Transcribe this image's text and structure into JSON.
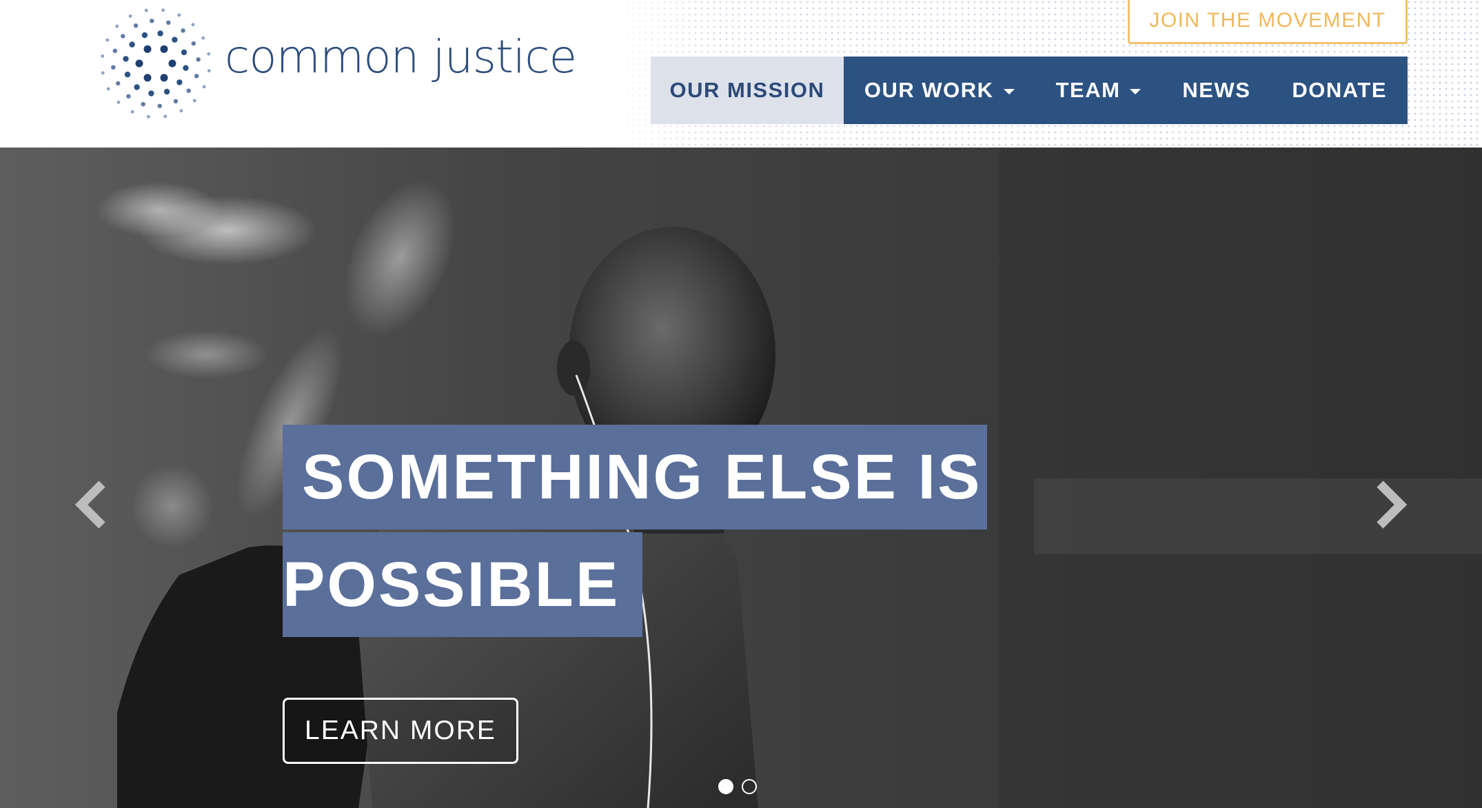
{
  "brand": {
    "name": "common justice",
    "logo_icon": "starburst-dots-icon",
    "color_primary": "#2c5282",
    "color_accent": "#f0b95c"
  },
  "header": {
    "cta_label": "JOIN THE MOVEMENT",
    "nav": [
      {
        "label": "OUR MISSION",
        "active": true,
        "dropdown": false
      },
      {
        "label": "OUR WORK",
        "active": false,
        "dropdown": true
      },
      {
        "label": "TEAM",
        "active": false,
        "dropdown": true
      },
      {
        "label": "NEWS",
        "active": false,
        "dropdown": false
      },
      {
        "label": "DONATE",
        "active": false,
        "dropdown": false
      }
    ]
  },
  "hero": {
    "headline_line1": "SOMETHING ELSE IS",
    "headline_line2": "POSSIBLE",
    "button_label": "LEARN MORE",
    "prev_icon": "chevron-left-icon",
    "next_icon": "chevron-right-icon",
    "slide_count": 2,
    "active_slide": 1,
    "headline_bg": "#5a6f9a"
  }
}
